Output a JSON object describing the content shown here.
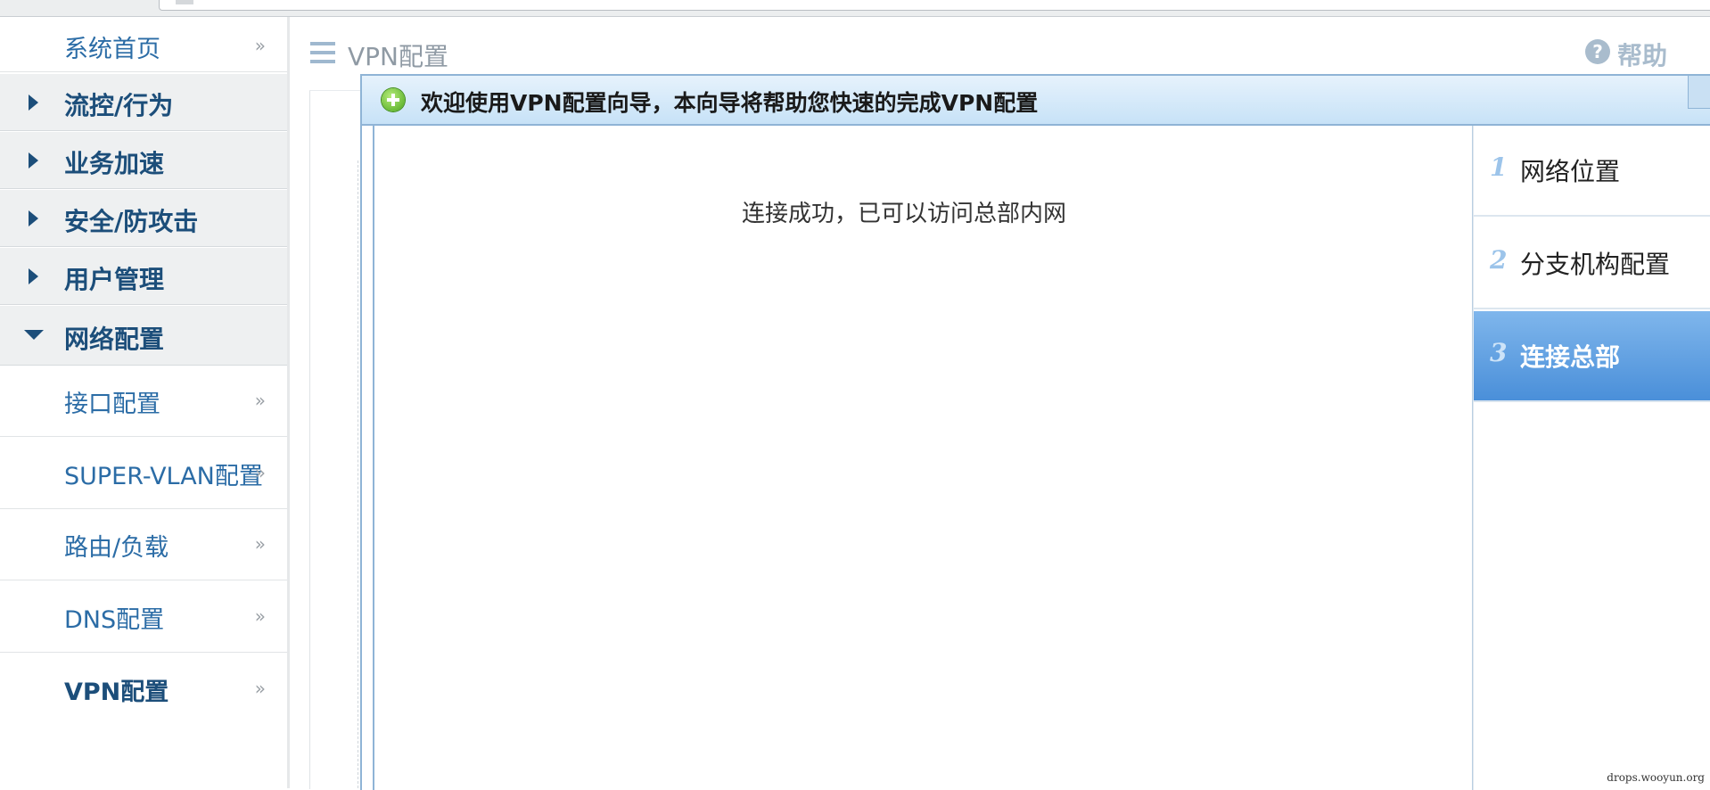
{
  "sidebar": {
    "home": {
      "label": "系统首页",
      "chevron": "»"
    },
    "groups": [
      {
        "label": "流控/行为"
      },
      {
        "label": "业务加速"
      },
      {
        "label": "安全/防攻击"
      },
      {
        "label": "用户管理"
      },
      {
        "label": "网络配置"
      }
    ],
    "sub_items": [
      {
        "label": "接口配置",
        "chevron": "»"
      },
      {
        "label": "SUPER-VLAN配置",
        "chevron": "»"
      },
      {
        "label": "路由/负载",
        "chevron": "»"
      },
      {
        "label": "DNS配置",
        "chevron": "»"
      },
      {
        "label": "VPN配置",
        "chevron": "»"
      }
    ]
  },
  "header": {
    "title": "VPN配置",
    "help_icon": "?",
    "help_label": "帮助"
  },
  "dialog": {
    "title": "欢迎使用VPN配置向导，本向导将帮助您快速的完成VPN配置",
    "message": "连接成功，已可以访问总部内网",
    "steps": [
      {
        "num": "1",
        "label": "网络位置"
      },
      {
        "num": "2",
        "label": "分支机构配置"
      },
      {
        "num": "3",
        "label": "连接总部"
      }
    ],
    "active_step": 3
  },
  "watermark": "drops.wooyun.org",
  "colors": {
    "accent": "#4a8fd9",
    "sidebar_text": "#2b6ca6",
    "dialog_border": "#8fb4d6"
  }
}
